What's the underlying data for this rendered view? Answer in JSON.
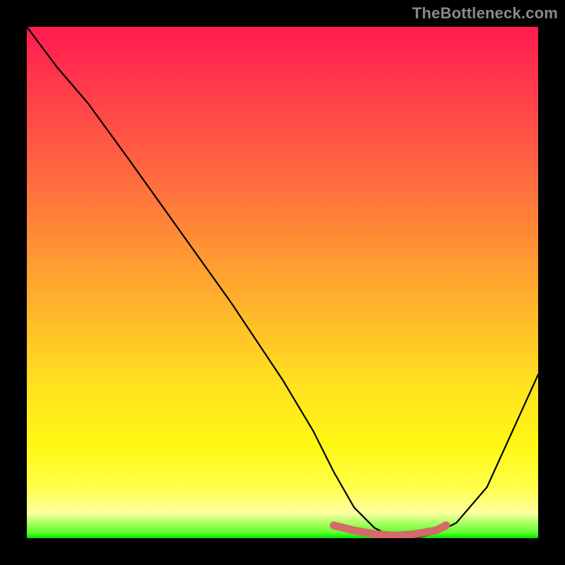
{
  "watermark": "TheBottleneck.com",
  "chart_data": {
    "type": "line",
    "title": "",
    "xlabel": "",
    "ylabel": "",
    "xlim": [
      0,
      100
    ],
    "ylim": [
      0,
      100
    ],
    "series": [
      {
        "name": "bottleneck-curve",
        "x": [
          0,
          6,
          12,
          20,
          30,
          40,
          50,
          56,
          60,
          64,
          68,
          72,
          76,
          80,
          84,
          90,
          100
        ],
        "y": [
          100,
          92,
          85,
          74,
          60,
          46,
          31,
          21,
          13,
          6,
          2,
          0,
          0,
          1,
          3,
          10,
          32
        ]
      },
      {
        "name": "trough-highlight",
        "x": [
          60,
          64,
          68,
          72,
          76,
          80,
          82
        ],
        "y": [
          2.5,
          1.5,
          0.8,
          0.5,
          0.8,
          1.5,
          2.5
        ]
      }
    ]
  }
}
